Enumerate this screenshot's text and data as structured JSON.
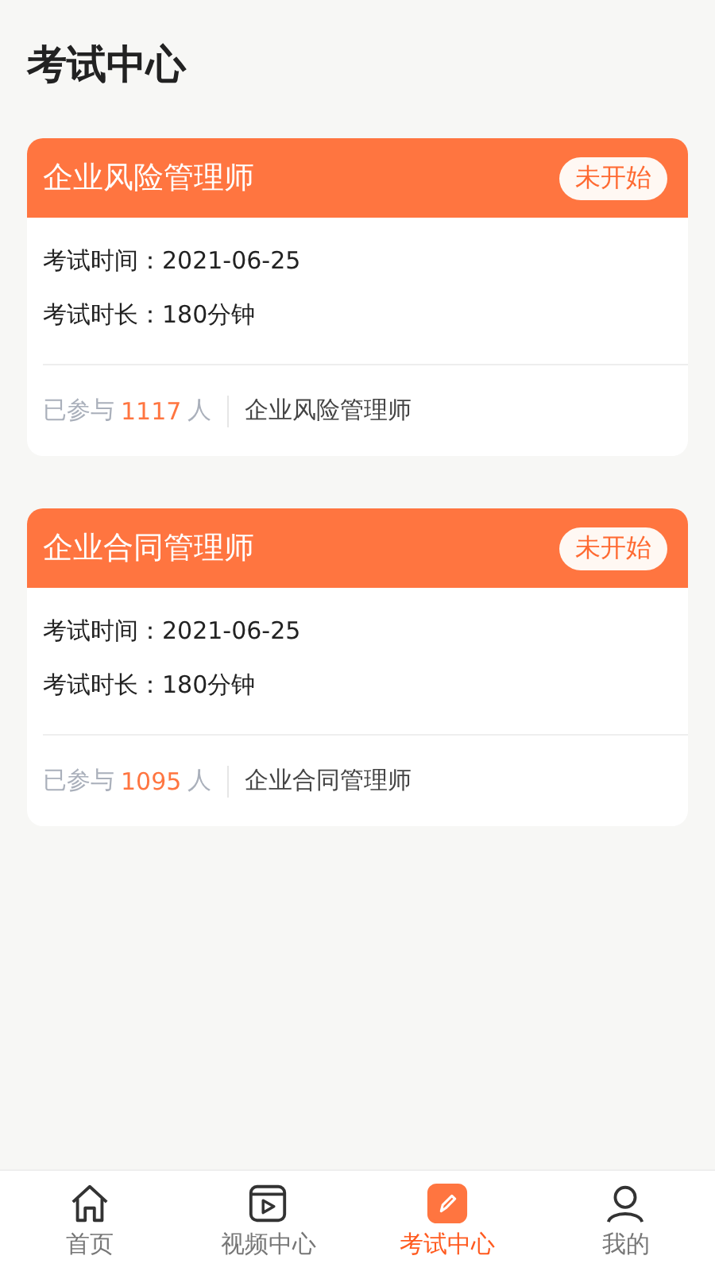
{
  "page_title": "考试中心",
  "exams": [
    {
      "title": "企业风险管理师",
      "status": "未开始",
      "details": [
        {
          "label": "考试时间：",
          "value": "2021-06-25"
        },
        {
          "label": "考试时长：",
          "value": "180分钟"
        }
      ],
      "participants_prefix": "已参与",
      "participants_count": "1117",
      "participants_suffix": "人",
      "category": "企业风险管理师"
    },
    {
      "title": "企业合同管理师",
      "status": "未开始",
      "details": [
        {
          "label": "考试时间：",
          "value": "2021-06-25"
        },
        {
          "label": "考试时长：",
          "value": "180分钟"
        }
      ],
      "participants_prefix": "已参与",
      "participants_count": "1095",
      "participants_suffix": "人",
      "category": "企业合同管理师"
    }
  ],
  "tab_bar": [
    {
      "kind": "home",
      "label": "首页",
      "selected": false
    },
    {
      "kind": "video",
      "label": "视频中心",
      "selected": false
    },
    {
      "kind": "exam",
      "label": "考试中心",
      "selected": true
    },
    {
      "kind": "profile",
      "label": "我的",
      "selected": false
    }
  ]
}
